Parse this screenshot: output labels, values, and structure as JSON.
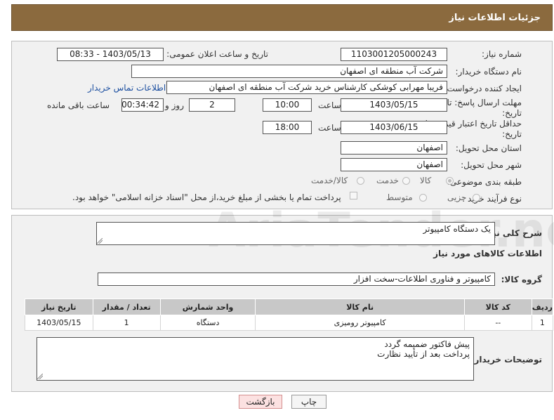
{
  "header": {
    "title": "جزئیات اطلاعات نیاز"
  },
  "info": {
    "need_number": {
      "label": "شماره نیاز:",
      "value": "1103001205000243"
    },
    "announce_datetime": {
      "label": "تاریخ و ساعت اعلان عمومی:",
      "value": "1403/05/13 - 08:33"
    },
    "buyer_org": {
      "label": "نام دستگاه خریدار:",
      "value": "شرکت آب منطقه ای اصفهان"
    },
    "requester": {
      "label": "ایجاد کننده درخواست:",
      "value": "فریبا مهرابی کوشکی کارشناس خرید شرکت آب منطقه ای اصفهان",
      "contact_link": "اطلاعات تماس خریدار"
    },
    "reply_deadline": {
      "label_line1": "مهلت ارسال پاسخ: تا",
      "label_line2": "تاریخ:",
      "date": "1403/05/15",
      "time_label": "ساعت",
      "time": "10:00",
      "days": "2",
      "days_label": "روز و",
      "remaining": "00:34:42",
      "remaining_label": "ساعت باقی مانده"
    },
    "price_validity": {
      "label_line1": "حداقل تاریخ اعتبار قیمت: تا",
      "label_line2": "تاریخ:",
      "date": "1403/06/15",
      "time_label": "ساعت",
      "time": "18:00"
    },
    "province": {
      "label": "استان محل تحویل:",
      "value": "اصفهان"
    },
    "city": {
      "label": "شهر محل تحویل:",
      "value": "اصفهان"
    },
    "category": {
      "label": "طبقه بندی موضوعی:",
      "options": [
        "کالا",
        "خدمت",
        "کالا/خدمت"
      ],
      "selected": "کالا"
    },
    "process": {
      "label": "نوع فرآیند خرید :",
      "options": [
        "جزیی",
        "متوسط"
      ],
      "note": "پرداخت تمام یا بخشی از مبلغ خرید،از محل \"اسناد خزانه اسلامی\" خواهد بود."
    }
  },
  "details": {
    "description_label": "شرح کلی نیاز:",
    "description": "یک دستگاه کامپیوتر",
    "goods_title": "اطلاعات کالاهای مورد نیاز",
    "goods_group_label": "گروه کالا:",
    "goods_group": "کامپیوتر و فناوری اطلاعات-سخت افزار",
    "table": {
      "headers": [
        "ردیف",
        "کد کالا",
        "نام کالا",
        "واحد شمارش",
        "تعداد / مقدار",
        "تاریخ نیاز"
      ],
      "rows": [
        [
          "1",
          "--",
          "کامپیوتر رومیزی",
          "دستگاه",
          "1",
          "1403/05/15"
        ]
      ]
    },
    "buyer_notes_label": "توضیحات خریدار:",
    "buyer_notes_line1": "پیش فاکتور ضمیمه گردد",
    "buyer_notes_line2": "پرداخت بعد از تأیید نظارت"
  },
  "buttons": {
    "print": "چاپ",
    "back": "بازگشت"
  },
  "watermark": "AriaTender.neT"
}
